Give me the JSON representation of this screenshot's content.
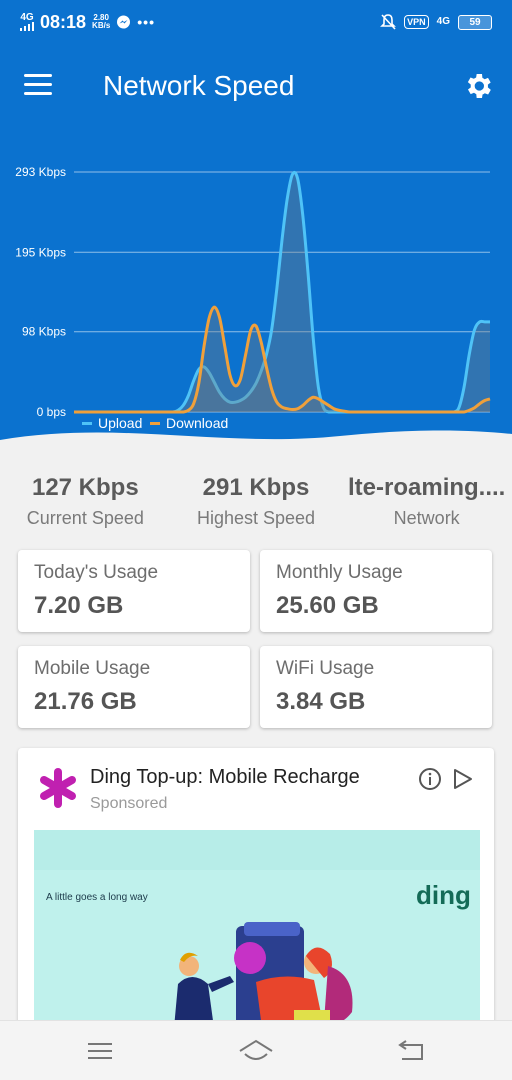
{
  "status_bar": {
    "network": "4G",
    "time": "08:18",
    "speed_value": "2.80",
    "speed_unit": "KB/s",
    "more": "•••",
    "vpn": "VPN",
    "network_right": "4G",
    "battery": "59"
  },
  "header": {
    "title": "Network Speed",
    "menu_icon": "hamburger-menu-icon",
    "settings_icon": "gear-icon"
  },
  "chart_data": {
    "type": "area",
    "y_ticks": [
      "293 Kbps",
      "195 Kbps",
      "98 Kbps",
      "0 bps"
    ],
    "ylim": [
      0,
      293
    ],
    "x": [
      0,
      1,
      2,
      3,
      4,
      5,
      6,
      7,
      8,
      9,
      10,
      11,
      12,
      13,
      14,
      15,
      16,
      17,
      18,
      19,
      20,
      21,
      22,
      23,
      24,
      25,
      26,
      27,
      28,
      29,
      30,
      31,
      32,
      33,
      34,
      35,
      36,
      37,
      38,
      39,
      40,
      41,
      42,
      43,
      44,
      45,
      46,
      47,
      48,
      49,
      50,
      51,
      52,
      53,
      54,
      55,
      56,
      57,
      58,
      59,
      60,
      61,
      62,
      63,
      64,
      65,
      66,
      67,
      68,
      69,
      70,
      71,
      72,
      73,
      74,
      75,
      76,
      77,
      78,
      79,
      80
    ],
    "series": [
      {
        "name": "Upload",
        "color": "#4fc3f7",
        "values": [
          0,
          0,
          0,
          0,
          0,
          0,
          0,
          0,
          0,
          0,
          0,
          0,
          0,
          0,
          0,
          0,
          0,
          0,
          0,
          0,
          2,
          8,
          20,
          38,
          52,
          55,
          48,
          36,
          24,
          16,
          12,
          12,
          14,
          18,
          25,
          35,
          50,
          70,
          100,
          150,
          210,
          260,
          290,
          285,
          240,
          170,
          90,
          30,
          5,
          0,
          0,
          0,
          0,
          0,
          0,
          0,
          0,
          0,
          0,
          0,
          0,
          0,
          0,
          0,
          0,
          0,
          0,
          0,
          0,
          0,
          0,
          0,
          0,
          0,
          5,
          30,
          70,
          100,
          110,
          110,
          110
        ]
      },
      {
        "name": "Download",
        "color": "#f0a03a",
        "values": [
          0,
          0,
          0,
          0,
          0,
          0,
          0,
          0,
          0,
          0,
          0,
          0,
          0,
          0,
          0,
          0,
          0,
          0,
          0,
          0,
          0,
          0,
          2,
          10,
          35,
          80,
          115,
          128,
          115,
          80,
          45,
          32,
          40,
          70,
          100,
          105,
          85,
          55,
          28,
          12,
          6,
          4,
          3,
          4,
          8,
          14,
          18,
          16,
          12,
          8,
          4,
          2,
          1,
          0,
          0,
          0,
          0,
          0,
          0,
          0,
          0,
          0,
          0,
          0,
          0,
          0,
          0,
          0,
          0,
          0,
          0,
          0,
          0,
          0,
          0,
          0,
          2,
          5,
          10,
          14,
          16
        ]
      }
    ],
    "legend": "bottom-left",
    "grid": true
  },
  "stats": [
    {
      "value": "127 Kbps",
      "label": "Current Speed"
    },
    {
      "value": "291 Kbps",
      "label": "Highest Speed"
    },
    {
      "value": "lte-roaming....",
      "label": "Network"
    }
  ],
  "usage": {
    "today": {
      "label": "Today's Usage",
      "value": "7.20 GB"
    },
    "monthly": {
      "label": "Monthly Usage",
      "value": "25.60 GB"
    },
    "mobile": {
      "label": "Mobile Usage",
      "value": "21.76 GB"
    },
    "wifi": {
      "label": "WiFi Usage",
      "value": "3.84 GB"
    }
  },
  "ad": {
    "title": "Ding Top-up: Mobile Recharge",
    "sponsored": "Sponsored",
    "tagline": "A little goes a long way",
    "brand": "ding",
    "brand_color": "#146b57",
    "logo_color": "#c020b0",
    "info_icon": "info-icon",
    "adchoices_icon": "adchoices-play-icon"
  },
  "navbar": {
    "menu_icon": "recent-apps-icon",
    "home_icon": "home-icon",
    "back_icon": "back-icon"
  },
  "colors": {
    "primary": "#0b72cf",
    "background": "#f1f1f1",
    "upload": "#4fc3f7",
    "download": "#f0a03a"
  }
}
